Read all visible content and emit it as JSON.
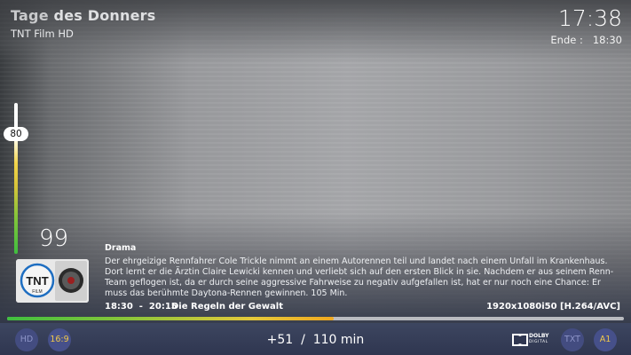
{
  "header": {
    "title_word1": "Tage",
    "title_word2": "des Donners",
    "channel": "TNT Film HD",
    "clock": "17:38",
    "end_label": "Ende :",
    "end_time": "18:30"
  },
  "volume": {
    "value": "80",
    "level": 0.8
  },
  "channel_number": "99",
  "channel_logo": {
    "text": "TNT",
    "sub": "FILM"
  },
  "program": {
    "genre": "Drama",
    "description": "Der ehrgeizige Rennfahrer Cole Trickle nimmt an einem Autorennen teil und landet nach einem Unfall im Krankenhaus. Dort lernt er die Ärztin Claire Lewicki kennen und verliebt sich auf den ersten Blick in sie. Nachdem er aus seinem Renn-Team geflogen ist, da er durch seine aggressive Fahrweise zu negativ aufgefallen ist, hat er nur noch eine Chance: Er muss das berühmte Daytona-Rennen gewinnen. 105 Min.",
    "time_range": "18:30  -  20:15",
    "next_title": "Die Regeln der Gewalt",
    "resolution": "1920x1080i50 [H.264/AVC]",
    "progress": 0.53
  },
  "footer": {
    "hd": "HD",
    "aspect": "16:9",
    "duration": "+51  /  110 min",
    "dolby": "DOLBY",
    "dolby_sub": "DIGITAL",
    "txt": "TXT",
    "audio": "A1"
  },
  "colors": {
    "bottom_bar": "#2f3650",
    "badge_bg": "#46508a",
    "badge_active_text": "#f0c84a",
    "progress_start": "#3fbf3f",
    "progress_end": "#f0a820"
  }
}
